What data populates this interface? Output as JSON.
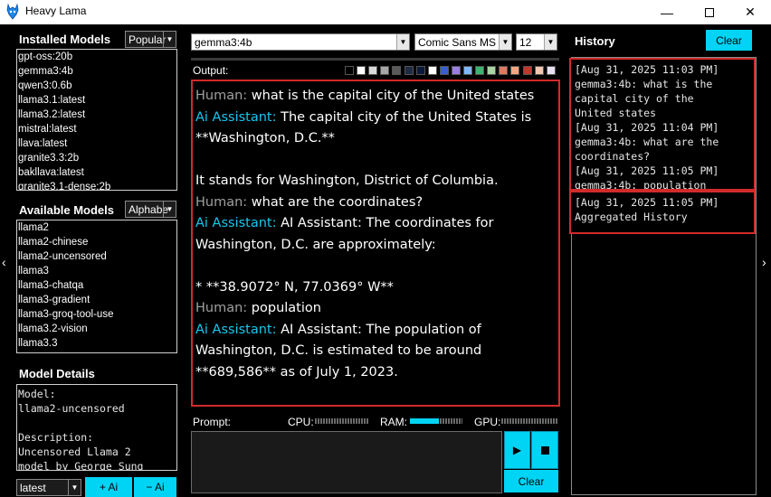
{
  "window": {
    "title": "Heavy Lama"
  },
  "installed": {
    "label": "Installed Models",
    "sort": "Popular",
    "items": [
      "gpt-oss:20b",
      "gemma3:4b",
      "qwen3:0.6b",
      "llama3.1:latest",
      "llama3.2:latest",
      "mistral:latest",
      "llava:latest",
      "granite3.3:2b",
      "bakllava:latest",
      "granite3.1-dense:2b"
    ]
  },
  "available": {
    "label": "Available Models",
    "sort": "Alphabe",
    "items": [
      "llama2",
      "llama2-chinese",
      "llama2-uncensored",
      "llama3",
      "llama3-chatqa",
      "llama3-gradient",
      "llama3-groq-tool-use",
      "llama3.2-vision",
      "llama3.3"
    ]
  },
  "details": {
    "label": "Model Details",
    "lines": [
      "Model:",
      "llama2-uncensored",
      "",
      "Description:",
      "Uncensored Llama 2",
      "model by George Sung"
    ]
  },
  "bottom_left": {
    "version": "latest",
    "add_label": "+ Ai",
    "remove_label": "− Ai"
  },
  "toolbar": {
    "model": "gemma3:4b",
    "font": "Comic Sans MS",
    "size": "12"
  },
  "output_label": "Output:",
  "swatches": [
    "#000000",
    "#ffffff",
    "#d9d9d9",
    "#a6a6a6",
    "#595959",
    "#1f2a44",
    "#0a1a3a",
    "#ffffff",
    "#3a5fcd",
    "#9a7fe0",
    "#7fb8ff",
    "#3cb371",
    "#a8d5a2",
    "#e07a5f",
    "#f4a582",
    "#c0392b",
    "#f2c6b0",
    "#e8e0f0"
  ],
  "chat": {
    "human_tag": "Human:",
    "ai_tag": "Ai Assistant:",
    "m1": " what is the capital city of the United states",
    "m2a": " The capital city of the United States is",
    "m2b": "**Washington, D.C.**",
    "m2c": "It stands for Washington, District of Columbia.",
    "m3": " what are the coordinates?",
    "m4a": " AI Assistant: The coordinates for",
    "m4b": "Washington, D.C. are approximately:",
    "m4c": "*   **38.9072° N, 77.0369° W**",
    "m5": " population",
    "m6a": " AI Assistant: The population of",
    "m6b": "Washington, D.C. is estimated to be around",
    "m6c": "**689,586** as of July 1, 2023."
  },
  "history": {
    "label": "History",
    "clear": "Clear",
    "top_lines": [
      "[Aug 31, 2025 11:03 PM]",
      "gemma3:4b: what is the",
      "capital city of the",
      "United states",
      "[Aug 31, 2025 11:04 PM]",
      "gemma3:4b: what are the",
      "coordinates?",
      "[Aug 31, 2025 11:05 PM]",
      "gemma3:4b: population"
    ],
    "bottom_lines": [
      "[Aug 31, 2025 11:05 PM]",
      "Aggregated History"
    ]
  },
  "prompt": {
    "label": "Prompt:",
    "cpu": "CPU:",
    "ram": "RAM:",
    "gpu": "GPU:",
    "ram_level": 0.55,
    "clear": "Clear",
    "value": ""
  },
  "colors": {
    "accent": "#00d4f5",
    "ai": "#16c7f0",
    "highlight": "#d32a2a"
  }
}
